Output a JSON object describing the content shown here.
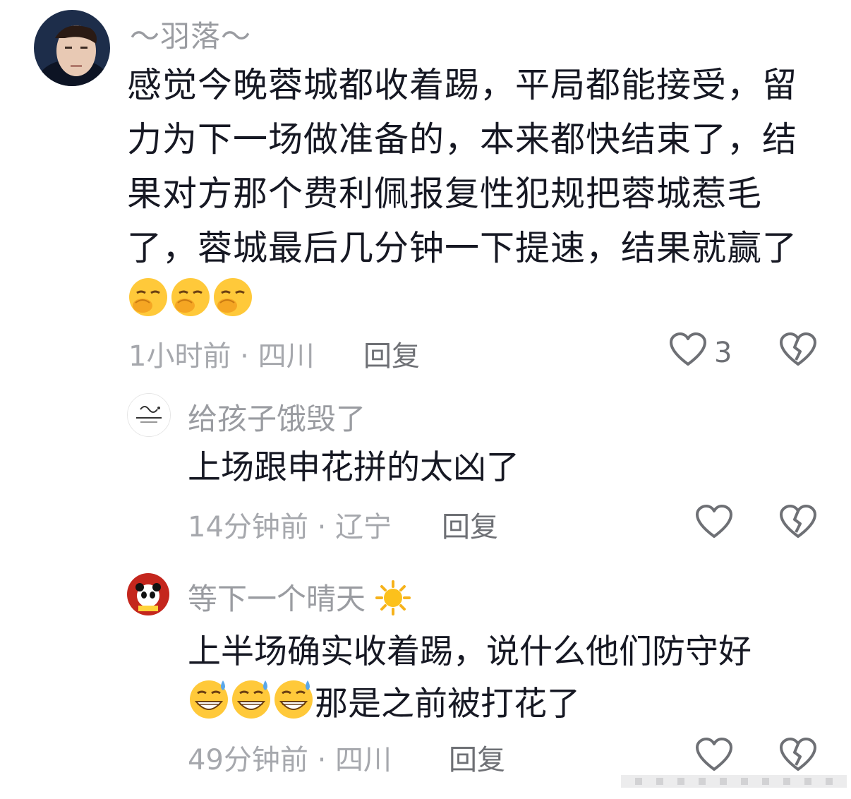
{
  "comments": [
    {
      "username": "～羽落～",
      "text": "感觉今晚蓉城都收着踢，平局都能接受，留力为下一场做准备的，本来都快结束了，结果对方那个费利佩报复性犯规把蓉城惹毛了，蓉城最后几分钟一下提速，结果就赢了",
      "emojis": [
        "face-with-hand-over-mouth",
        "face-with-hand-over-mouth",
        "face-with-hand-over-mouth"
      ],
      "meta": "1小时前 · 四川",
      "reply_label": "回复",
      "like_count": "3"
    },
    {
      "username": "给孩子饿毁了",
      "text": "上场跟申花拼的太凶了",
      "meta": "14分钟前 · 辽宁",
      "reply_label": "回复"
    },
    {
      "username": "等下一个晴天",
      "username_emoji": "sun",
      "text_line1": "上半场确实收着踢，说什么他们防守好",
      "text_line2_emojis": [
        "grinning-face-with-sweat",
        "grinning-face-with-sweat",
        "grinning-face-with-sweat"
      ],
      "text_line2": "那是之前被打花了",
      "meta": "49分钟前 · 四川",
      "reply_label": "回复"
    }
  ],
  "icons": {
    "like": "heart-outline-icon",
    "dislike": "broken-heart-icon"
  },
  "colors": {
    "text": "#161823",
    "username": "#9a9ca1",
    "meta": "#a6a8ad",
    "reply": "#6e7075"
  }
}
